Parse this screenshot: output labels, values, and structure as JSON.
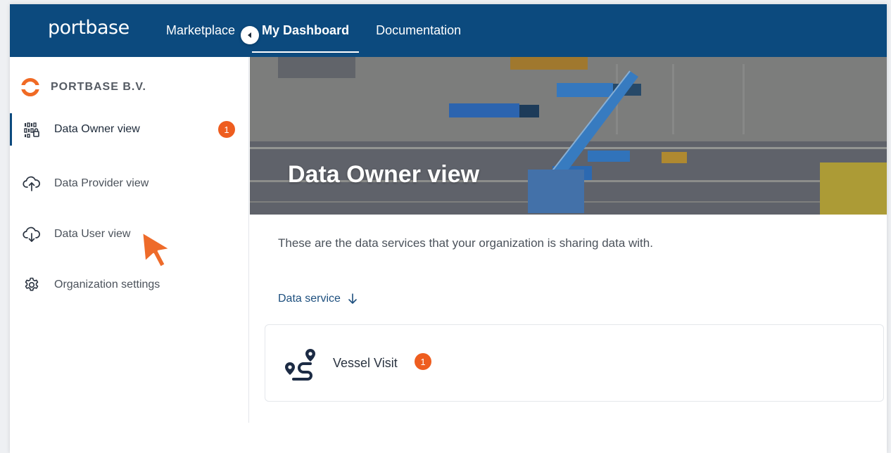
{
  "header": {
    "logo_text": "portbase",
    "nav": [
      {
        "label": "Marketplace",
        "active": false
      },
      {
        "label": "My Dashboard",
        "active": true
      },
      {
        "label": "Documentation",
        "active": false
      }
    ]
  },
  "sidebar": {
    "org_name": "PORTBASE B.V.",
    "items": [
      {
        "label": "Data Owner view",
        "icon": "data-owner-icon",
        "active": true,
        "badge": "1"
      },
      {
        "label": "Data Provider view",
        "icon": "cloud-upload-icon",
        "active": false
      },
      {
        "label": "Data User view",
        "icon": "cloud-download-icon",
        "active": false
      },
      {
        "label": "Organization settings",
        "icon": "gear-icon",
        "active": false
      }
    ]
  },
  "main": {
    "hero_title": "Data Owner view",
    "intro": "These are the data services that your organization is sharing data with.",
    "sort_label": "Data service",
    "services": [
      {
        "name": "Vessel Visit",
        "icon": "route-icon",
        "badge": "1"
      }
    ]
  },
  "colors": {
    "nav_bg": "#0c4a7e",
    "accent": "#ee5d1f",
    "link": "#1d4f7e"
  }
}
